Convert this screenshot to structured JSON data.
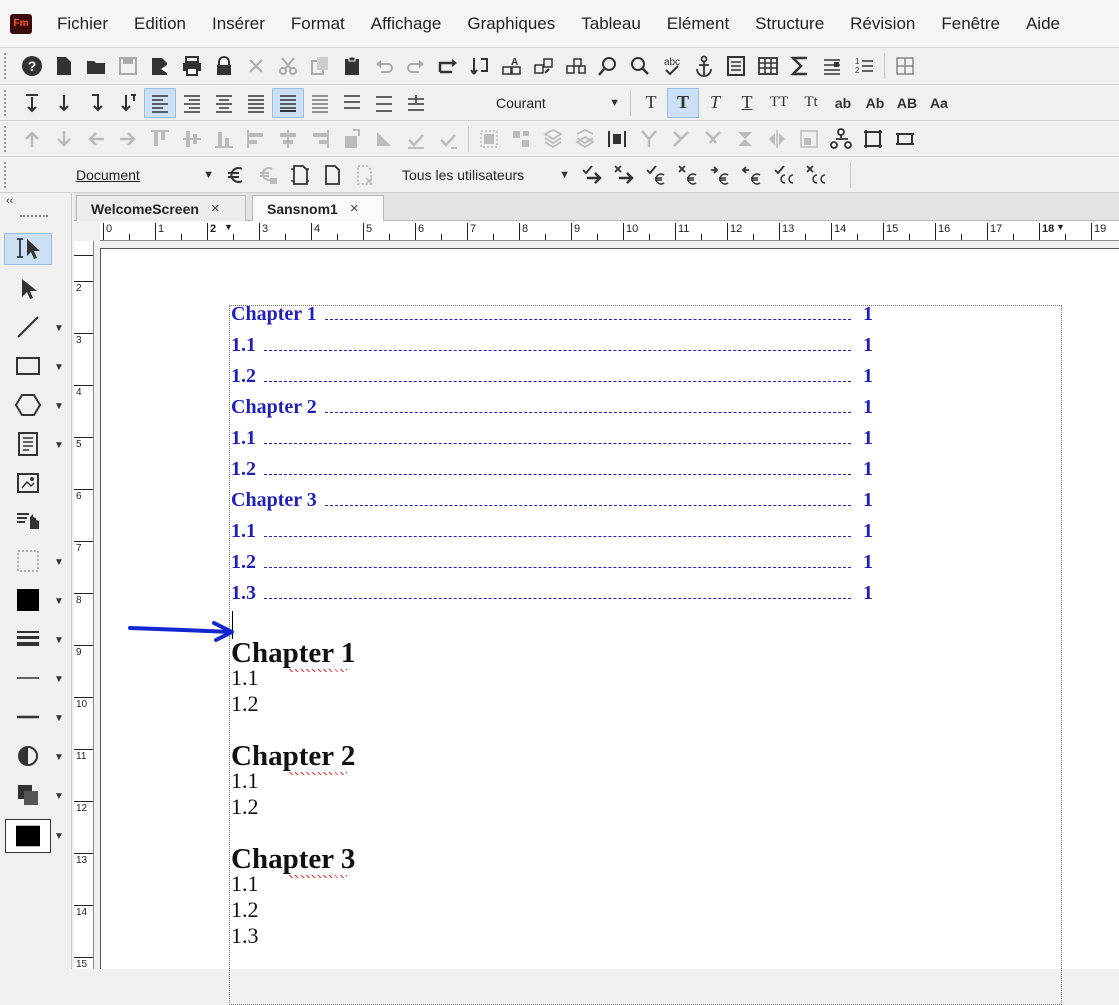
{
  "app": {
    "logo_text": "Fm"
  },
  "menu": [
    "Fichier",
    "Edition",
    "Insérer",
    "Format",
    "Affichage",
    "Graphiques",
    "Tableau",
    "Elément",
    "Structure",
    "Révision",
    "Fenêtre",
    "Aide"
  ],
  "toolbar2": {
    "paragraph_format": "Courant",
    "char_buttons": [
      "T",
      "T",
      "T",
      "T",
      "TT",
      "Tt",
      "ab",
      "Ab",
      "AB",
      "Aa"
    ]
  },
  "toolbar4": {
    "document_select": "Document",
    "users_select": "Tous les utilisateurs"
  },
  "tabs": [
    {
      "label": "WelcomeScreen",
      "close": "×"
    },
    {
      "label": "Sansnom1",
      "close": "×"
    }
  ],
  "ruler": {
    "h_numbers": [
      "0",
      "1",
      "2",
      "3",
      "4",
      "5",
      "6",
      "7",
      "8",
      "9",
      "10",
      "11",
      "12",
      "13",
      "14",
      "15",
      "16",
      "17",
      "18",
      "19"
    ],
    "v_numbers": [
      "2",
      "3",
      "4",
      "5",
      "6",
      "7",
      "8",
      "9",
      "10",
      "11",
      "12",
      "13",
      "14",
      "15"
    ]
  },
  "toc": [
    {
      "text": "Chapter 1",
      "page": "1"
    },
    {
      "text": "1.1",
      "page": "1"
    },
    {
      "text": "1.2",
      "page": "1"
    },
    {
      "text": "Chapter 2",
      "page": "1"
    },
    {
      "text": "1.1",
      "page": "1"
    },
    {
      "text": "1.2",
      "page": "1"
    },
    {
      "text": "Chapter 3",
      "page": "1"
    },
    {
      "text": "1.1",
      "page": "1"
    },
    {
      "text": "1.2",
      "page": "1"
    },
    {
      "text": "1.3",
      "page": "1"
    }
  ],
  "body": [
    {
      "heading": "Chapter 1",
      "sections": [
        "1.1",
        "1.2"
      ]
    },
    {
      "heading": "Chapter 2",
      "sections": [
        "1.1",
        "1.2"
      ]
    },
    {
      "heading": "Chapter 3",
      "sections": [
        "1.1",
        "1.2",
        "1.3"
      ]
    }
  ],
  "colors": {
    "toc_blue": "#1f1fbe",
    "annotation_arrow": "#1428d2",
    "selected": "#cce0f5"
  }
}
